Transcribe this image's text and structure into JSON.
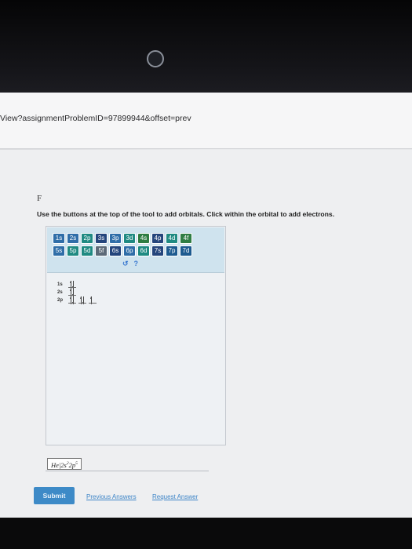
{
  "browser": {
    "url": "View?assignmentProblemID=97899944&offset=prev"
  },
  "question": {
    "label": "F",
    "instructions": "Use the buttons at the top of the tool to add orbitals. Click within the orbital to add electrons."
  },
  "orbital_tool": {
    "buttons_row1": [
      "1s",
      "2s",
      "2p",
      "3s",
      "3p",
      "3d",
      "4s",
      "4p",
      "4d",
      "4f"
    ],
    "buttons_row2": [
      "5s",
      "5p",
      "5d",
      "5f",
      "6s",
      "6p",
      "6d",
      "7s",
      "7p",
      "7d"
    ],
    "tools": {
      "reset_icon": "reset-icon",
      "help_icon": "help-icon",
      "reset_glyph": "↺",
      "help_glyph": "?"
    },
    "diagram": [
      {
        "label": "1s",
        "boxes": [
          [
            "up",
            "down"
          ]
        ]
      },
      {
        "label": "2s",
        "boxes": [
          [
            "up",
            "down"
          ]
        ]
      },
      {
        "label": "2p",
        "boxes": [
          [
            "up",
            "down"
          ],
          [
            "up",
            "down"
          ],
          [
            "up"
          ]
        ]
      }
    ]
  },
  "answer": {
    "core": "He",
    "s_term": "2s",
    "s_exp": "2",
    "p_term": "2p",
    "p_exp": "5"
  },
  "actions": {
    "submit": "Submit",
    "previous_answers": "Previous Answers",
    "request_answer": "Request Answer"
  }
}
